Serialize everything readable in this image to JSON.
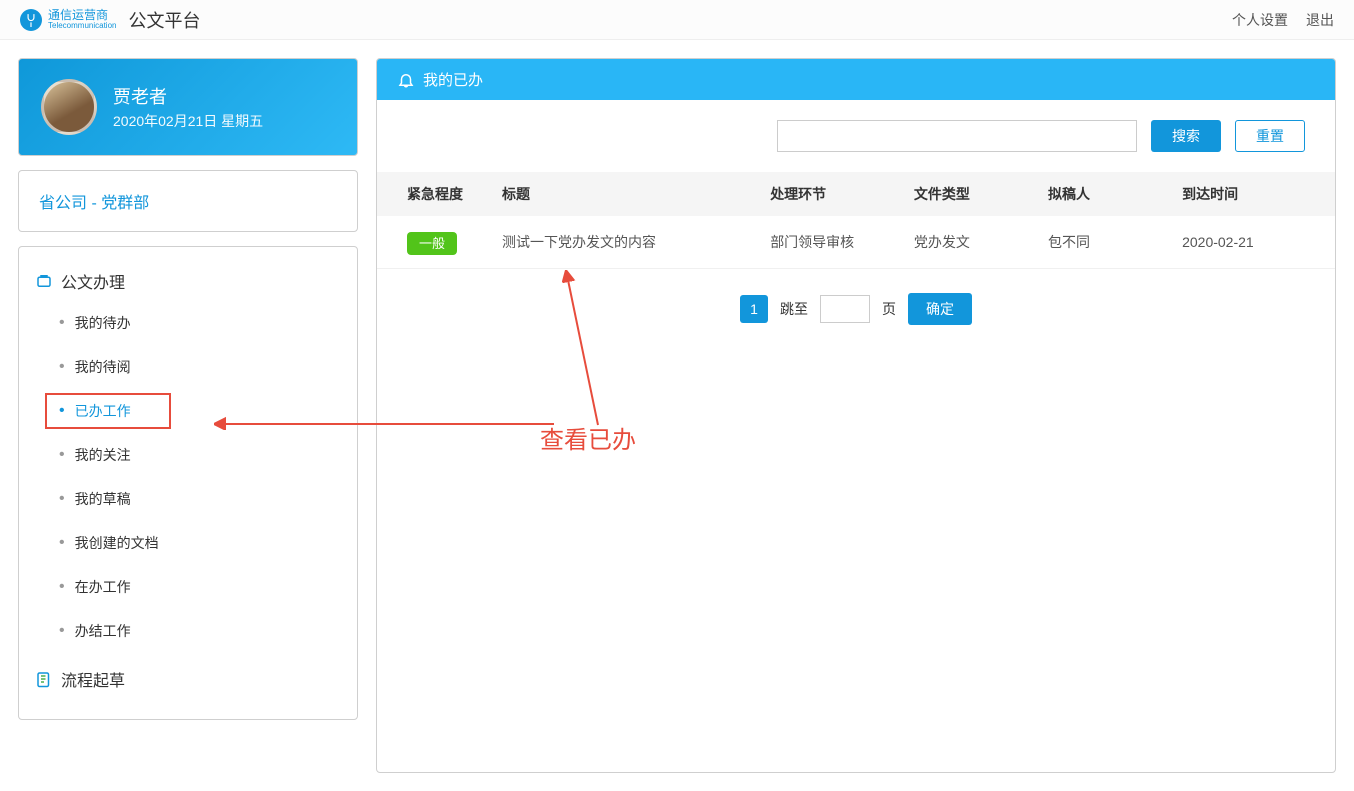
{
  "header": {
    "brand_line1": "通信运营商",
    "brand_line2": "Telecommunication",
    "app_title": "公文平台",
    "links": {
      "settings": "个人设置",
      "logout": "退出"
    }
  },
  "user": {
    "name": "贾老者",
    "date": "2020年02月21日 星期五"
  },
  "org_path": "省公司 - 党群部",
  "nav": {
    "section_doc": "公文办理",
    "items": [
      "我的待办",
      "我的待阅",
      "已办工作",
      "我的关注",
      "我的草稿",
      "我创建的文档",
      "在办工作",
      "办结工作"
    ],
    "active_index": 2,
    "section_flow": "流程起草"
  },
  "panel": {
    "title": "我的已办",
    "search_label": "搜索",
    "reset_label": "重置"
  },
  "table": {
    "headers": [
      "紧急程度",
      "标题",
      "处理环节",
      "文件类型",
      "拟稿人",
      "到达时间"
    ],
    "rows": [
      {
        "urgency": "一般",
        "title": "测试一下党办发文的内容",
        "stage": "部门领导审核",
        "type": "党办发文",
        "drafter": "包不同",
        "arrival": "2020-02-21"
      }
    ]
  },
  "pager": {
    "current": "1",
    "jump_label_pre": "跳至",
    "jump_label_post": "页",
    "confirm": "确定"
  },
  "annotation": {
    "label": "查看已办"
  }
}
